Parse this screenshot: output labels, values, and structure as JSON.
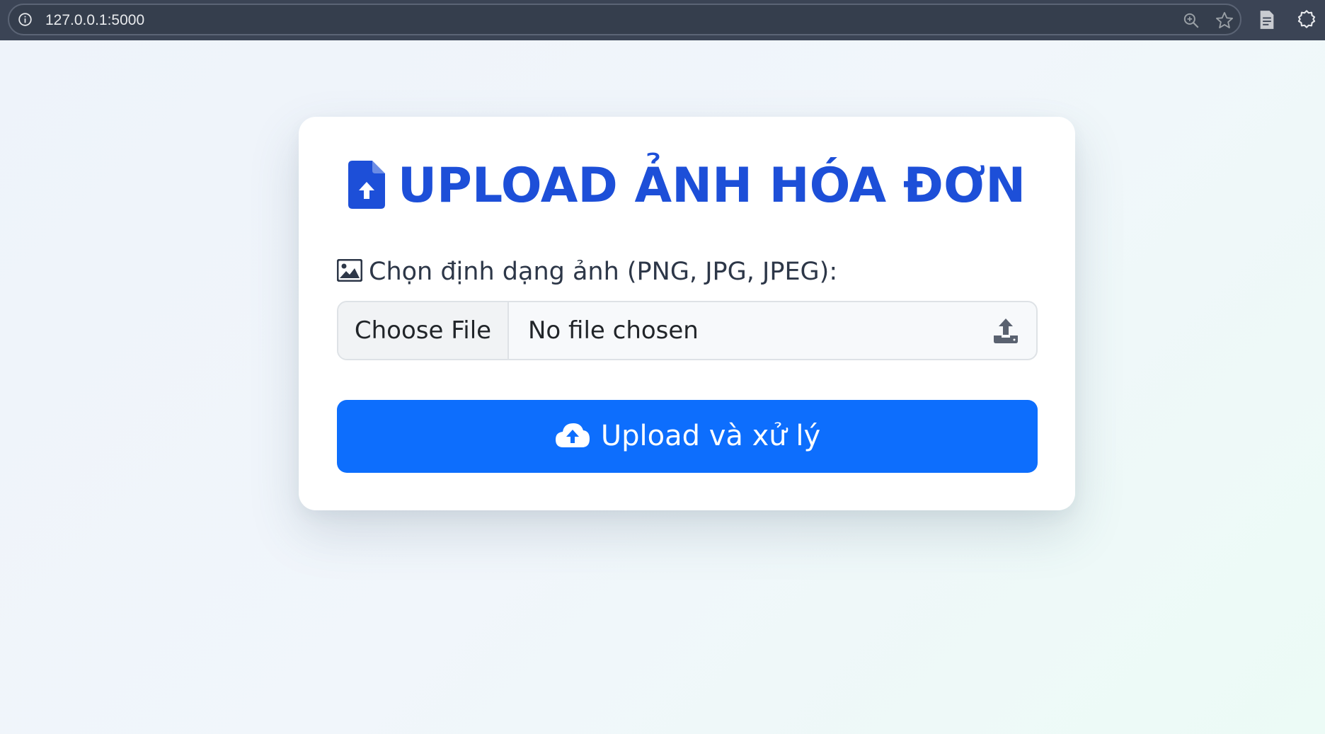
{
  "browser": {
    "url": "127.0.0.1:5000",
    "icons": [
      "info-icon",
      "zoom-icon",
      "bookmark-star-icon",
      "reading-mode-icon",
      "extensions-icon"
    ]
  },
  "card": {
    "title": "UPLOAD ẢNH HÓA ĐƠN",
    "title_icon": "file-upload-icon",
    "file_label": "Chọn định dạng ảnh (PNG, JPG, JPEG):",
    "file_label_icon": "image-icon",
    "file_input": {
      "button_label": "Choose File",
      "status_text": "No file chosen",
      "icon": "upload-tray-icon"
    },
    "submit": {
      "label": "Upload và xử lý",
      "icon": "cloud-upload-icon"
    }
  },
  "colors": {
    "browser_bar": "#3b4455",
    "title": "#1d4fd8",
    "button": "#0d6efd",
    "text": "#2d3748"
  }
}
